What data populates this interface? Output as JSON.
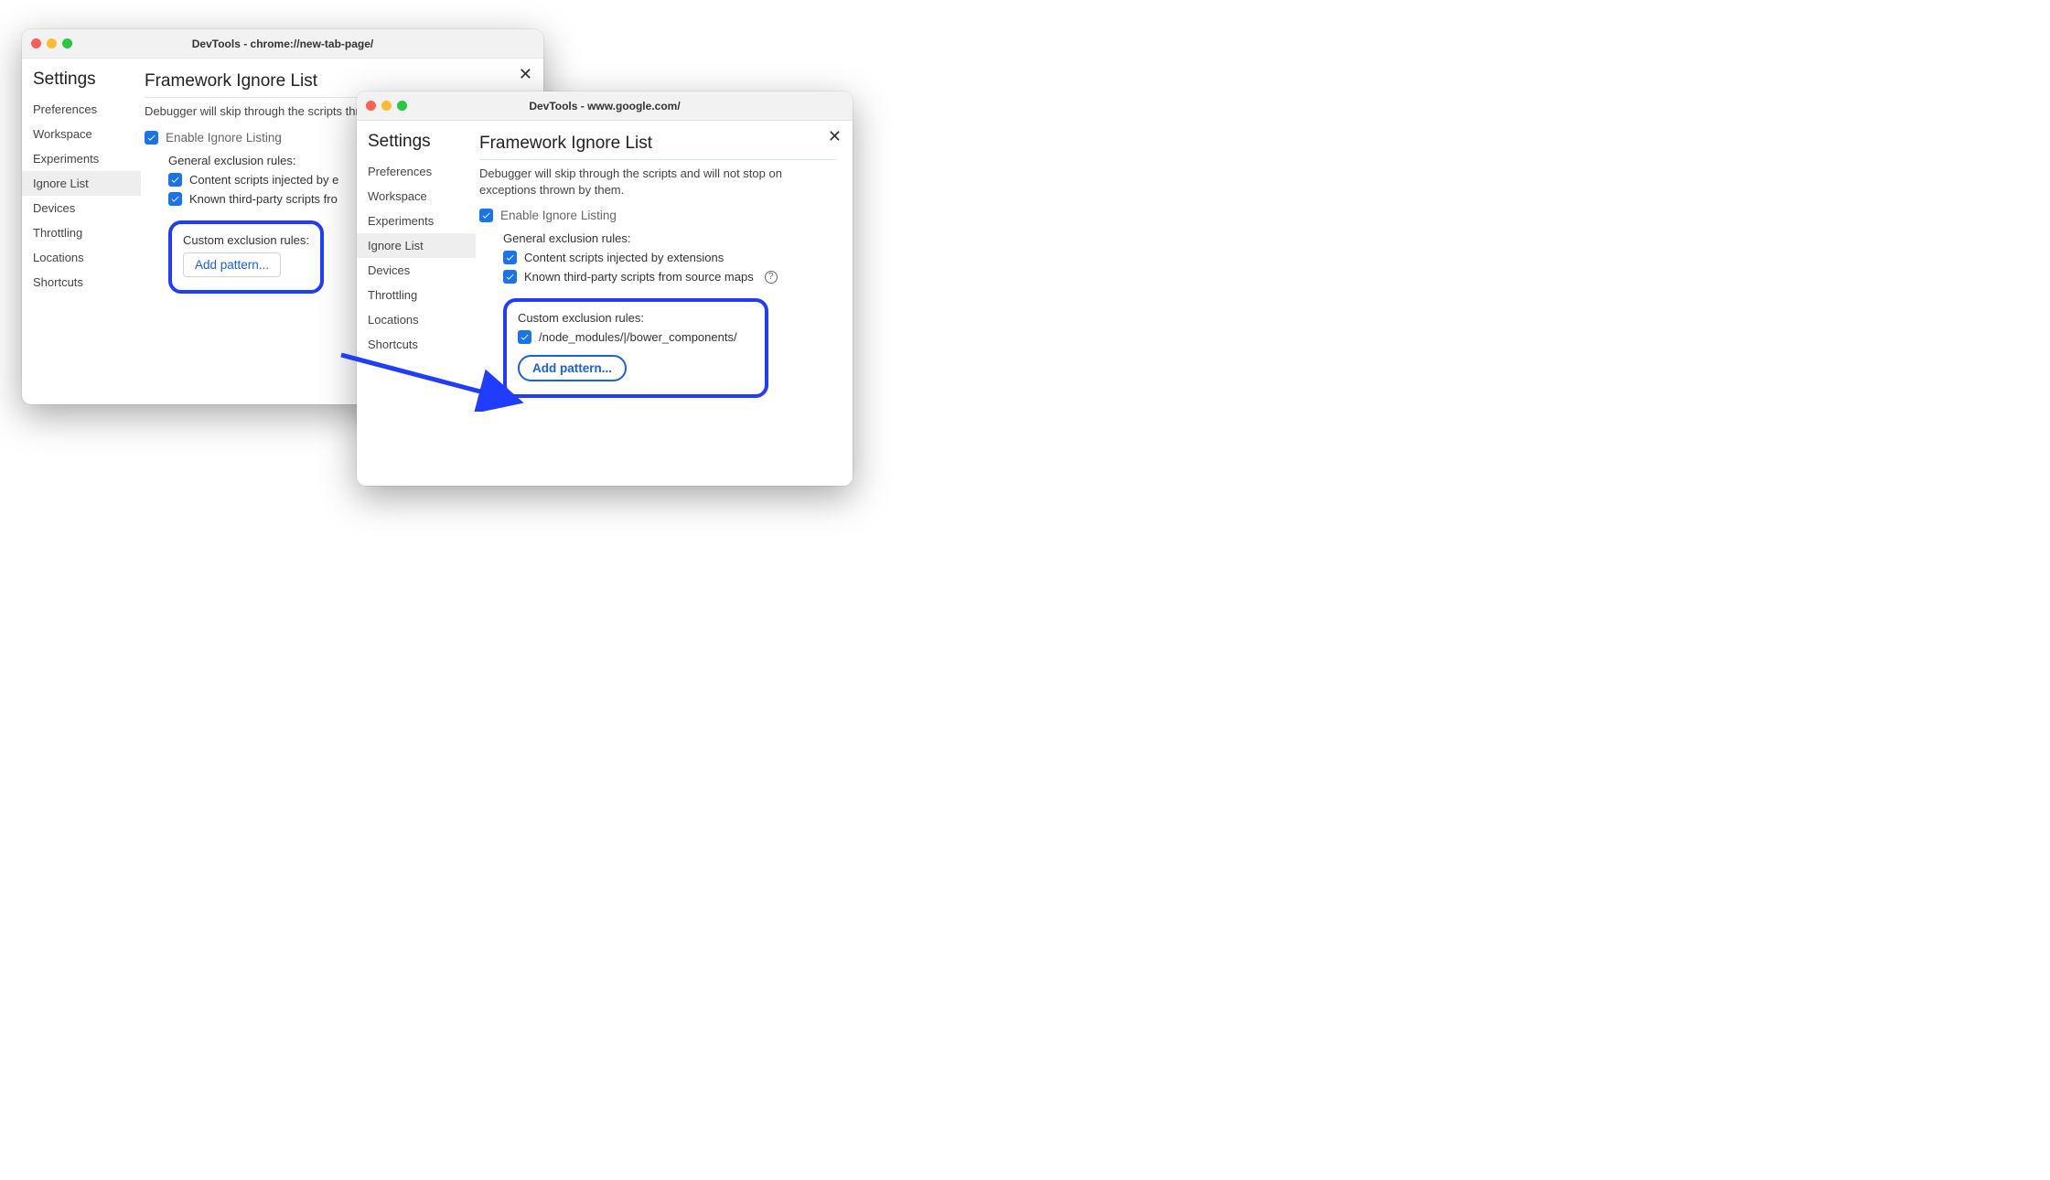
{
  "windows": {
    "w1": {
      "title": "DevTools - chrome://new-tab-page/"
    },
    "w2": {
      "title": "DevTools - www.google.com/"
    }
  },
  "sidebar": {
    "heading": "Settings",
    "items": [
      "Preferences",
      "Workspace",
      "Experiments",
      "Ignore List",
      "Devices",
      "Throttling",
      "Locations",
      "Shortcuts"
    ]
  },
  "panel": {
    "heading": "Framework Ignore List",
    "description_full": "Debugger will skip through the scripts and will not stop on exceptions thrown by them.",
    "description_cut1": "Debugger will skip through the scripts thrown by them.",
    "enable_label": "Enable Ignore Listing",
    "general_label": "General exclusion rules:",
    "rule_content_full": "Content scripts injected by extensions",
    "rule_content_cut": "Content scripts injected by e",
    "rule_thirdparty_full": "Known third-party scripts from source maps",
    "rule_thirdparty_cut": "Known third-party scripts fro",
    "custom_label": "Custom exclusion rules:",
    "add_button": "Add pattern...",
    "custom_pattern": "/node_modules/|/bower_components/"
  }
}
